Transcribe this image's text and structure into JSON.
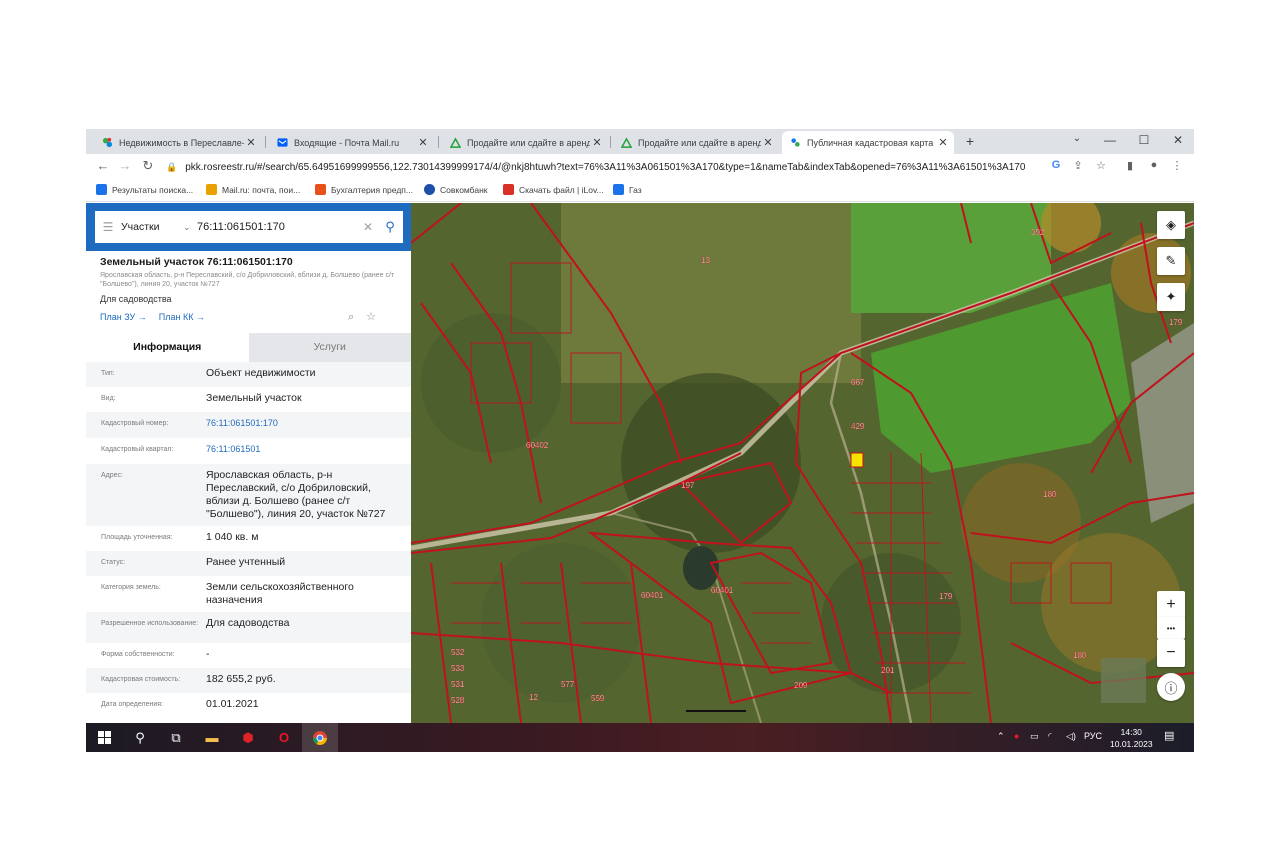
{
  "browser": {
    "tabs": [
      {
        "title": "Недвижимость в Переславле-З",
        "active": false
      },
      {
        "title": "Входящие - Почта Mail.ru",
        "active": false
      },
      {
        "title": "Продайте или сдайте в аренду",
        "active": false
      },
      {
        "title": "Продайте или сдайте в аренду",
        "active": false
      },
      {
        "title": "Публичная кадастровая карта",
        "active": true
      }
    ],
    "new_tab": "+",
    "url": "pkk.rosreestr.ru/#/search/65.64951699999556,122.73014399999174/4/@nkj8htuwh?text=76%3A11%3A061501%3A170&type=1&nameTab&indexTab&opened=76%3A11%3A61501%3A170",
    "bookmarks": [
      {
        "label": "Результаты поиска...",
        "color": "#1a73e8"
      },
      {
        "label": "Mail.ru: почта, пои...",
        "color": "#e8a100"
      },
      {
        "label": "Бухгалтерия предп...",
        "color": "#e8501a"
      },
      {
        "label": "Совкомбанк",
        "color": "#1e4fa8"
      },
      {
        "label": "Скачать файл | iLov...",
        "color": "#d93025"
      },
      {
        "label": "Газ",
        "color": "#1a73e8"
      }
    ]
  },
  "search": {
    "kind": "Участки",
    "query": "76:11:061501:170"
  },
  "object": {
    "title": "Земельный участок 76:11:061501:170",
    "address_small": "Ярославская область, р-н Переславский, с/о Добриловский, вблизи д. Болшево (ранее с/т \"Болшево\"), линия 20, участок №727",
    "use": "Для садоводства",
    "plan_zu": "План ЗУ →",
    "plan_kk": "План КК →"
  },
  "info_tabs": [
    "Информация",
    "Услуги"
  ],
  "properties": [
    {
      "label": "Тип:",
      "value": "Объект недвижимости",
      "link": false
    },
    {
      "label": "Вид:",
      "value": "Земельный участок",
      "link": false
    },
    {
      "label": "Кадастровый номер:",
      "value": "76:11:061501:170",
      "link": true
    },
    {
      "label": "Кадастровый квартал:",
      "value": "76:11:061501",
      "link": true
    },
    {
      "label": "Адрес:",
      "value": "Ярославская область, р-н Переславский, с/о Добриловский, вблизи д. Болшево (ранее с/т \"Болшево\"), линия 20, участок №727",
      "link": false
    },
    {
      "label": "Площадь уточненная:",
      "value": "1 040 кв. м",
      "link": false
    },
    {
      "label": "Статус:",
      "value": "Ранее учтенный",
      "link": false
    },
    {
      "label": "Категория земель:",
      "value": "Земли сельскохозяйственного назначения",
      "link": false
    },
    {
      "label": "Разрешенное использование:",
      "value": "Для садоводства",
      "link": false
    },
    {
      "label": "Форма собственности:",
      "value": "-",
      "link": false
    },
    {
      "label": "Кадастровая стоимость:",
      "value": "182 655,2 руб.",
      "link": false
    },
    {
      "label": "Дата определения:",
      "value": "01.01.2021",
      "link": false
    }
  ],
  "map": {
    "parcel_labels": [
      "13",
      "392",
      "179",
      "180",
      "180",
      "60401",
      "60402",
      "60401",
      "667",
      "429",
      "197",
      "577",
      "559",
      "532",
      "533",
      "531",
      "528",
      "12",
      "209",
      "201",
      "179"
    ],
    "buttons": {
      "layers": "layers-icon",
      "ruler": "ruler-icon",
      "locate": "locate-icon",
      "zoom_in": "+",
      "zoom_more": "•••",
      "zoom_out": "−",
      "info": "info-icon"
    }
  },
  "taskbar": {
    "lang": "РУС",
    "time": "14:30",
    "date": "10.01.2023"
  },
  "colors": {
    "accent": "#1f6bbf",
    "parcel_stroke": "#c0121c",
    "selected_parcel": "#f5e400"
  }
}
